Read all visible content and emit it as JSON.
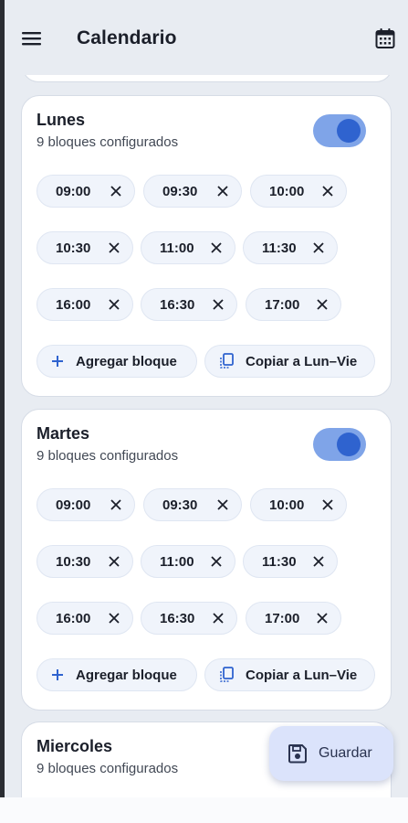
{
  "app_bar": {
    "title": "Calendario",
    "menu_icon": "menu-icon",
    "action_icon": "calendar-icon"
  },
  "days": [
    {
      "name": "Lunes",
      "count_label": "9 bloques configurados",
      "enabled": true,
      "slots": [
        "09:00",
        "09:30",
        "10:00",
        "10:30",
        "11:00",
        "11:30",
        "16:00",
        "16:30",
        "17:00"
      ]
    },
    {
      "name": "Martes",
      "count_label": "9 bloques configurados",
      "enabled": true,
      "slots": [
        "09:00",
        "09:30",
        "10:00",
        "10:30",
        "11:00",
        "11:30",
        "16:00",
        "16:30",
        "17:00"
      ]
    },
    {
      "name": "Miercoles",
      "count_label": "9 bloques configurados"
    }
  ],
  "actions": {
    "add_label": "Agregar bloque",
    "copy_label": "Copiar a Lun–Vie"
  },
  "fab": {
    "label": "Guardar",
    "icon": "save-icon"
  },
  "colors": {
    "accent": "#2f63cf",
    "toggle_track": "#7fa4e8",
    "chip_bg": "#f0f4fb",
    "fab_bg": "#dbe3fb",
    "background": "#e8ecf2"
  }
}
